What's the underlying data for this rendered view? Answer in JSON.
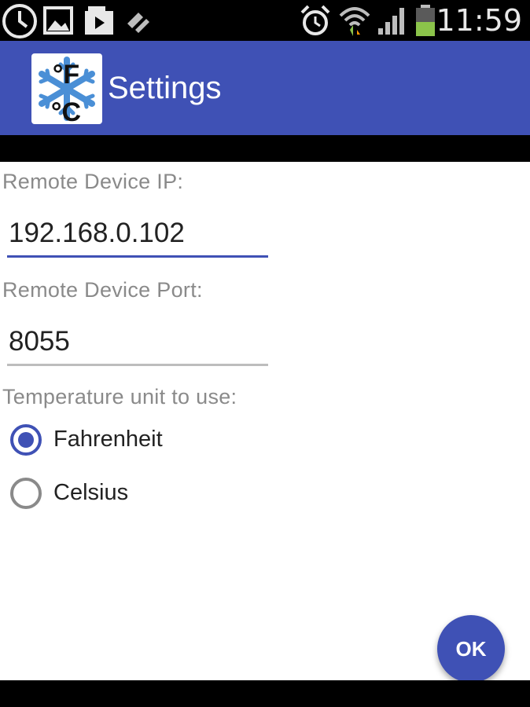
{
  "status_bar": {
    "time": "11:59",
    "icons": [
      "clock-icon",
      "image-icon",
      "media-icon",
      "sync-icon",
      "alarm-icon",
      "wifi-icon",
      "signal-icon",
      "battery-icon"
    ]
  },
  "app_bar": {
    "title": "Settings",
    "logo": {
      "top": "°F",
      "bottom": "°C",
      "icon": "snowflake-icon"
    }
  },
  "form": {
    "ip": {
      "label": "Remote Device IP:",
      "value": "192.168.0.102"
    },
    "port": {
      "label": "Remote Device Port:",
      "value": "8055"
    },
    "unit": {
      "label": "Temperature unit to use:",
      "options": [
        {
          "label": "Fahrenheit",
          "selected": true
        },
        {
          "label": "Celsius",
          "selected": false
        }
      ]
    }
  },
  "fab": {
    "label": "OK"
  },
  "colors": {
    "primary": "#3f51b5",
    "accent": "#3f51b5",
    "label_gray": "#8a8a8a",
    "battery_green": "#8bc34a"
  }
}
